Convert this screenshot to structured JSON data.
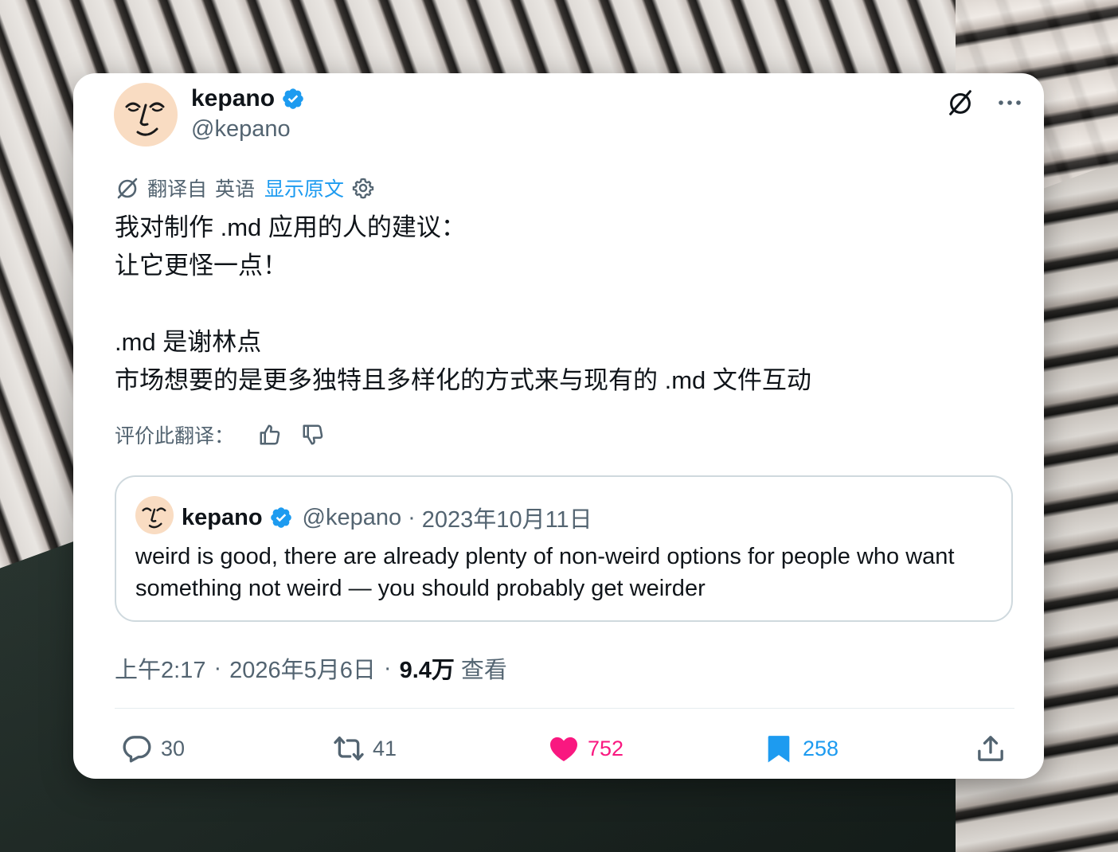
{
  "author": {
    "name": "kepano",
    "handle": "@kepano"
  },
  "translation": {
    "translated_from": "翻译自",
    "language": "英语",
    "show_original": "显示原文"
  },
  "body_lines": [
    "我对制作 .md 应用的人的建议：",
    "让它更怪一点！",
    "",
    ".md 是谢林点",
    "市场想要的是更多独特且多样化的方式来与现有的 .md 文件互动"
  ],
  "rate_translation": {
    "label": "评价此翻译："
  },
  "quoted_tweet": {
    "name": "kepano",
    "handle": "@kepano",
    "separator": "·",
    "date": "2023年10月11日",
    "text": "weird is good, there are already plenty of non-weird options for people who want something not weird — you should probably get weirder"
  },
  "meta": {
    "time": "上午2:17",
    "separator": "·",
    "date": "2026年5月6日",
    "views_count": "9.4万",
    "views_label": "查看"
  },
  "actions": {
    "replies": "30",
    "reposts": "41",
    "likes": "752",
    "bookmarks": "258"
  },
  "colors": {
    "accent_blue": "#1d9bf0",
    "like_pink": "#f91880",
    "secondary_text": "#536471",
    "primary_text": "#0f1419",
    "avatar_bg": "#f9dcc2"
  }
}
